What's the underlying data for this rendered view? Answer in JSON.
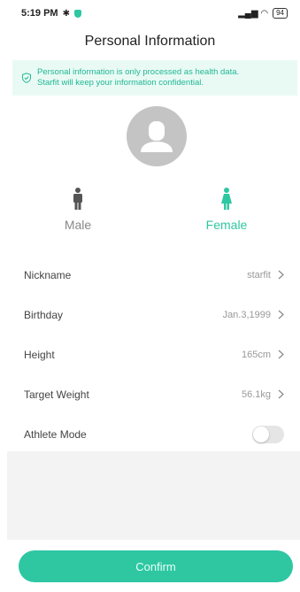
{
  "status_bar": {
    "time": "5:19 PM",
    "signal": "▂▄▆ ◠",
    "battery": "94"
  },
  "header": {
    "title": "Personal Information"
  },
  "notice": {
    "line1": "Personal information is only processed as health data.",
    "line2": "Starfit will keep your information confidential."
  },
  "gender": {
    "male_label": "Male",
    "female_label": "Female",
    "selected": "Female"
  },
  "fields": [
    {
      "label": "Nickname",
      "value": "starfit"
    },
    {
      "label": "Birthday",
      "value": "Jan.3,1999"
    },
    {
      "label": "Height",
      "value": "165cm"
    },
    {
      "label": "Target Weight",
      "value": "56.1kg"
    }
  ],
  "athlete_mode": {
    "label": "Athlete Mode",
    "enabled": false
  },
  "confirm_label": "Confirm",
  "colors": {
    "accent": "#2ec7a2",
    "notice_bg": "#e9faf4"
  }
}
